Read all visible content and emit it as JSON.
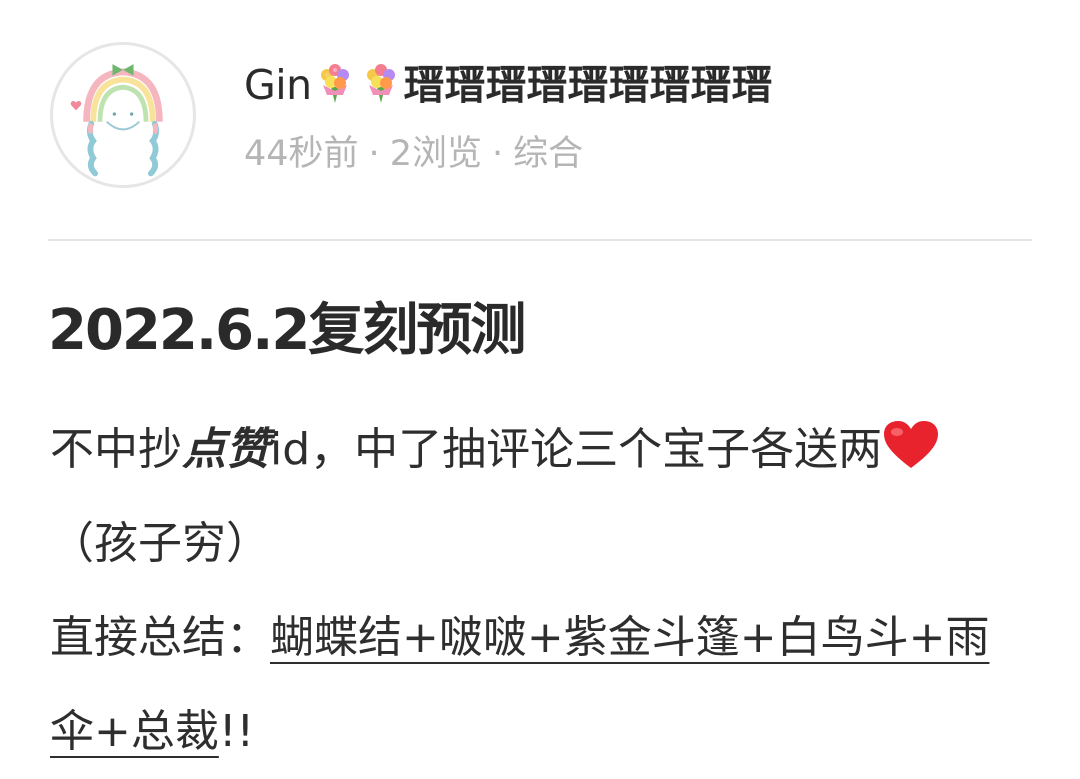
{
  "author": {
    "name_prefix": "Gin",
    "name_suffix": "瑨瑨瑨瑨瑨瑨瑨瑨瑨"
  },
  "meta": {
    "time": "44秒前",
    "views": "2浏览",
    "category": "综合"
  },
  "post": {
    "title": "2022.6.2复刻预测",
    "line1_a": "不中抄",
    "line1_bold": "点赞",
    "line1_b": "id，中了抽评论三个宝子各送两",
    "line2": "（孩子穷）",
    "summary_label": "直接总结：",
    "summary_link_1": "蝴蝶结+啵啵+紫金斗篷+白鸟斗+雨",
    "summary_link_2": "伞+总裁",
    "summary_tail": "!!"
  },
  "colors": {
    "meta_gray": "#b5b5b5",
    "heart_red": "#e8232e",
    "divider": "#e4e4e4"
  },
  "icons": {
    "avatar": "rainbow-girl-avatar",
    "bouquet": "bouquet-icon",
    "heart": "red-heart-icon"
  }
}
